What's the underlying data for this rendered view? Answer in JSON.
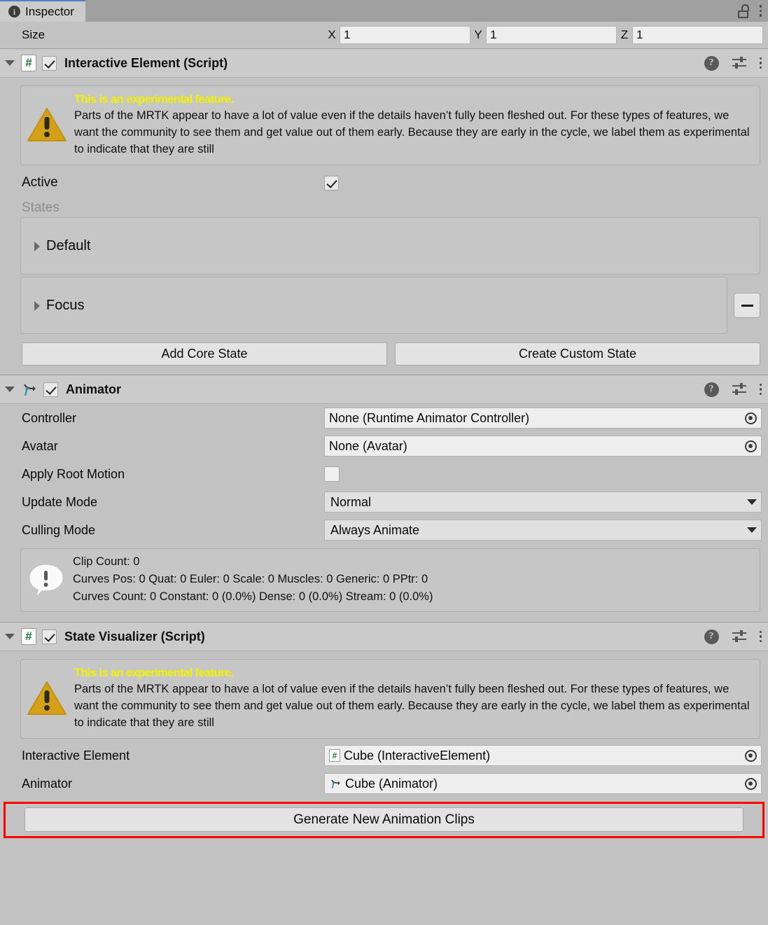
{
  "window": {
    "tab_label": "Inspector",
    "tab_icon": "info-icon",
    "lock_icon": "unlocked-padlock-icon",
    "menu_icon": "kebab-menu-icon"
  },
  "size_row": {
    "label": "Size",
    "axes": [
      {
        "axis": "X",
        "value": "1"
      },
      {
        "axis": "Y",
        "value": "1"
      },
      {
        "axis": "Z",
        "value": "1"
      }
    ]
  },
  "experimental_warning": {
    "heading": "This is an experimental feature.",
    "body": "Parts of the MRTK appear to have a lot of value even if the details haven’t fully been fleshed out. For these types of features, we want the community to see them and get value out of them early. Because they are early in the cycle, we label them as experimental to indicate that they are still",
    "icon": "warning-triangle-icon",
    "heading_color": "#f2f200",
    "icon_color": "#d4a017"
  },
  "components": [
    {
      "id": "interactive-element",
      "title": "Interactive Element (Script)",
      "icon": "script-hash-icon",
      "enabled": true,
      "expanded": true,
      "header_icons": [
        "help-icon",
        "preset-icon",
        "kebab-menu-icon"
      ]
    },
    {
      "id": "animator",
      "title": "Animator",
      "icon": "animator-icon",
      "enabled": true,
      "expanded": true,
      "header_icons": [
        "help-icon",
        "preset-icon",
        "kebab-menu-icon"
      ]
    },
    {
      "id": "state-visualizer",
      "title": "State Visualizer (Script)",
      "icon": "script-hash-icon",
      "enabled": true,
      "expanded": true,
      "header_icons": [
        "help-icon",
        "preset-icon",
        "kebab-menu-icon"
      ]
    }
  ],
  "interactive_element": {
    "active": {
      "label": "Active",
      "checked": true
    },
    "states_label": "States",
    "states": [
      {
        "name": "Default",
        "expanded": false,
        "removable": false
      },
      {
        "name": "Focus",
        "expanded": false,
        "removable": true
      }
    ],
    "buttons": [
      {
        "label": "Add Core State"
      },
      {
        "label": "Create Custom State"
      }
    ]
  },
  "animator": {
    "fields": [
      {
        "label": "Controller",
        "type": "object",
        "value": "None (Runtime Animator Controller)",
        "picker": true
      },
      {
        "label": "Avatar",
        "type": "object",
        "value": "None (Avatar)",
        "picker": true
      },
      {
        "label": "Apply Root Motion",
        "type": "checkbox",
        "checked": false
      },
      {
        "label": "Update Mode",
        "type": "enum",
        "value": "Normal"
      },
      {
        "label": "Culling Mode",
        "type": "enum",
        "value": "Always Animate"
      }
    ],
    "info": {
      "icon": "info-bubble-icon",
      "line1": "Clip Count: 0",
      "line2": "Curves Pos: 0 Quat: 0 Euler: 0 Scale: 0 Muscles: 0 Generic: 0 PPtr: 0",
      "line3": "Curves Count: 0 Constant: 0 (0.0%) Dense: 0 (0.0%) Stream: 0 (0.0%)"
    }
  },
  "state_visualizer": {
    "fields": [
      {
        "label": "Interactive Element",
        "value": "Cube (InteractiveElement)",
        "icon": "script-hash-icon"
      },
      {
        "label": "Animator",
        "value": "Cube (Animator)",
        "icon": "animator-icon"
      }
    ],
    "generate_button": {
      "label": "Generate New Animation Clips",
      "highlight_color": "#ff0000"
    }
  }
}
